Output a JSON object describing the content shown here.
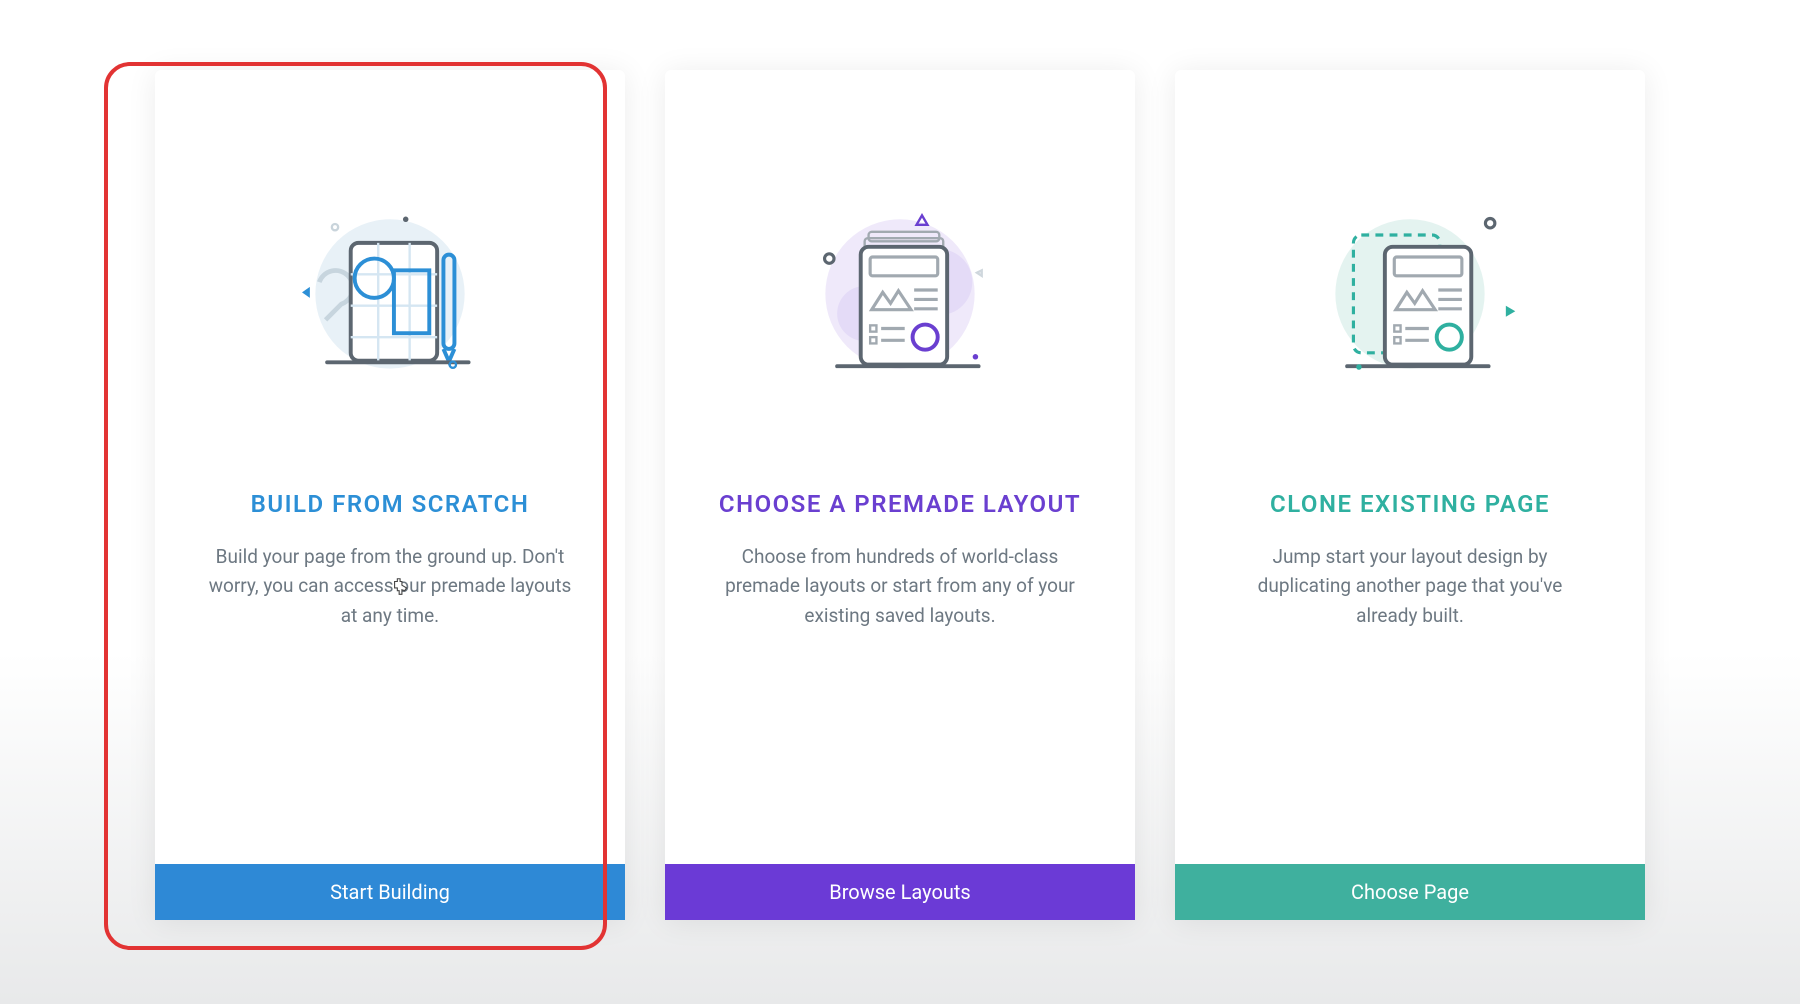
{
  "cards": [
    {
      "title": "BUILD FROM SCRATCH",
      "description": "Build your page from the ground up. Don't worry, you can access our premade layouts at any time.",
      "button": "Start Building",
      "accent": "#2c8fd6",
      "btnColor": "#2e89d6"
    },
    {
      "title": "CHOOSE A PREMADE LAYOUT",
      "description": "Choose from hundreds of world-class premade layouts or start from any of your existing saved layouts.",
      "button": "Browse Layouts",
      "accent": "#6a3fd0",
      "btnColor": "#6b3ad6"
    },
    {
      "title": "CLONE EXISTING PAGE",
      "description": "Jump start your layout design by duplicating another page that you've already built.",
      "button": "Choose Page",
      "accent": "#2fb0a0",
      "btnColor": "#3fb09e"
    }
  ]
}
